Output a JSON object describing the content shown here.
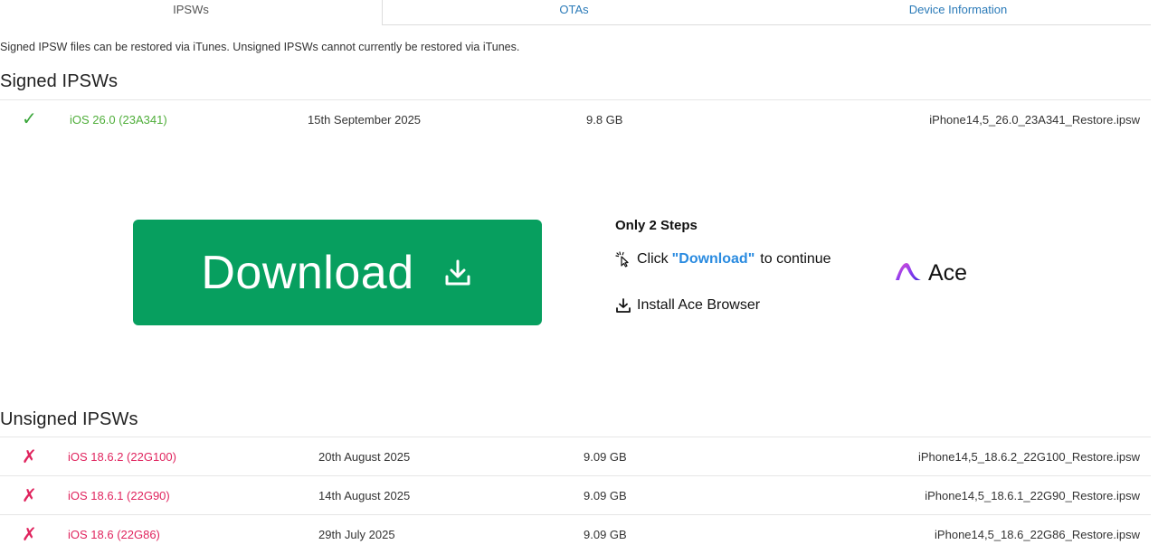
{
  "tabs": [
    {
      "label": "IPSWs",
      "active": true
    },
    {
      "label": "OTAs",
      "active": false
    },
    {
      "label": "Device Information",
      "active": false
    }
  ],
  "intro": "Signed IPSW files can be restored via iTunes. Unsigned IPSWs cannot currently be restored via iTunes.",
  "signed": {
    "heading": "Signed IPSWs",
    "rows": [
      {
        "mark": "✓",
        "version": "iOS 26.0 (23A341)",
        "date": "15th September 2025",
        "size": "9.8 GB",
        "file": "iPhone14,5_26.0_23A341_Restore.ipsw"
      }
    ]
  },
  "ad": {
    "button_label": "Download",
    "steps_title": "Only 2 Steps",
    "step1_prefix": "Click",
    "step1_highlight": "\"Download\"",
    "step1_suffix": "to continue",
    "step2": "Install Ace Browser",
    "brand": "Ace",
    "brand_color": "#079f5f"
  },
  "unsigned": {
    "heading": "Unsigned IPSWs",
    "rows": [
      {
        "mark": "✗",
        "version": "iOS 18.6.2 (22G100)",
        "date": "20th August 2025",
        "size": "9.09 GB",
        "file": "iPhone14,5_18.6.2_22G100_Restore.ipsw"
      },
      {
        "mark": "✗",
        "version": "iOS 18.6.1 (22G90)",
        "date": "14th August 2025",
        "size": "9.09 GB",
        "file": "iPhone14,5_18.6.1_22G90_Restore.ipsw"
      },
      {
        "mark": "✗",
        "version": "iOS 18.6 (22G86)",
        "date": "29th July 2025",
        "size": "9.09 GB",
        "file": "iPhone14,5_18.6_22G86_Restore.ipsw"
      }
    ]
  },
  "colors": {
    "signed": "#4fae3a",
    "unsigned": "#e0245e",
    "link": "#2a7ab8"
  }
}
